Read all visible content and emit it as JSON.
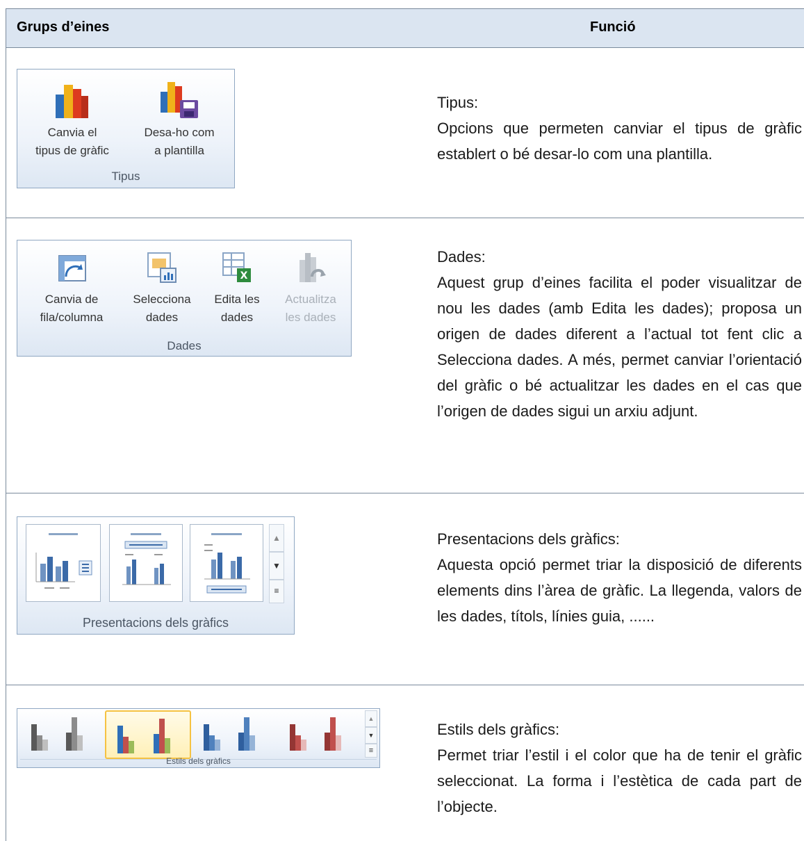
{
  "header": {
    "col1": "Grups d’eines",
    "col2": "Funció"
  },
  "rows": [
    {
      "group": "Tipus",
      "buttons": [
        "Canvia el tipus de gràfic",
        "Desa-ho com a plantilla"
      ],
      "buttons_lines": [
        [
          "Canvia el",
          "tipus de gràfic"
        ],
        [
          "Desa-ho com",
          "a plantilla"
        ]
      ],
      "title": "Tipus:",
      "text": "Opcions que permeten canviar el tipus de gràfic establert o bé desar-lo com una plantilla."
    },
    {
      "group": "Dades",
      "buttons_lines": [
        [
          "Canvia de",
          "fila/columna"
        ],
        [
          "Selecciona",
          "dades"
        ],
        [
          "Edita les",
          "dades"
        ],
        [
          "Actualitza",
          "les dades"
        ]
      ],
      "title": "Dades:",
      "text": "Aquest grup d’eines facilita el poder visualitzar de nou les dades (amb Edita les dades); proposa un origen de dades diferent a l’actual tot fent clic a Selecciona dades. A més, permet canviar l’orientació del gràfic o bé actualitzar les dades en el cas que l’origen de dades sigui un arxiu adjunt."
    },
    {
      "group": "Presentacions dels gràfics",
      "title": "Presentacions dels gràfics:",
      "text": "Aquesta opció permet triar la disposició de diferents elements dins l’àrea de gràfic. La llegenda, valors de les dades, títols, línies guia, ......"
    },
    {
      "group": "Estils dels gràfics",
      "title": "Estils dels gràfics:",
      "text": "Permet triar l’estil i el color que ha de tenir el gràfic seleccionat. La forma i l’estètica de cada part de l’objecte."
    }
  ],
  "colors": {
    "header_bg": "#dbe5f1",
    "border": "#7a8a9c",
    "selected": "#f5c242"
  }
}
